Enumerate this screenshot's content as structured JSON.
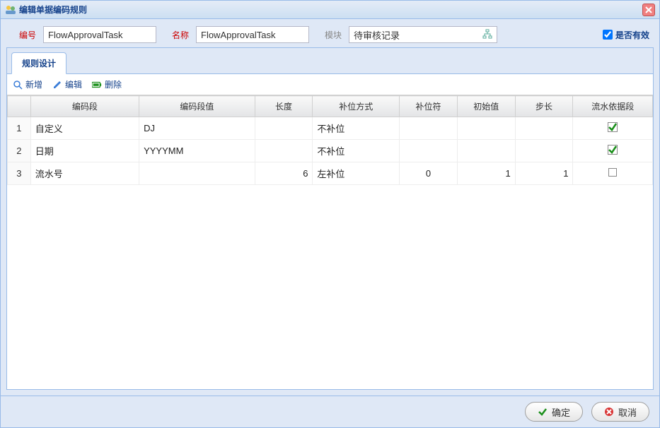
{
  "window": {
    "title": "编辑单据编码规则"
  },
  "form": {
    "id_label": "编号",
    "id_value": "FlowApprovalTask",
    "name_label": "名称",
    "name_value": "FlowApprovalTask",
    "module_label": "模块",
    "module_value": "待审核记录",
    "enabled_label": "是否有效",
    "enabled_checked": true
  },
  "tabs": {
    "rule_design": "规则设计"
  },
  "toolbar": {
    "add": "新增",
    "edit": "编辑",
    "delete": "删除"
  },
  "columns": {
    "rownum": "",
    "segment": "编码段",
    "segment_value": "编码段值",
    "length": "长度",
    "padding_mode": "补位方式",
    "padding_char": "补位符",
    "initial_value": "初始值",
    "step": "步长",
    "serial_by": "流水依据段"
  },
  "rows": [
    {
      "n": "1",
      "segment": "自定义",
      "segment_value": "DJ",
      "length": "",
      "padding_mode": "不补位",
      "padding_char": "",
      "initial_value": "",
      "step": "",
      "serial_by": true
    },
    {
      "n": "2",
      "segment": "日期",
      "segment_value": "YYYYMM",
      "length": "",
      "padding_mode": "不补位",
      "padding_char": "",
      "initial_value": "",
      "step": "",
      "serial_by": true
    },
    {
      "n": "3",
      "segment": "流水号",
      "segment_value": "",
      "length": "6",
      "padding_mode": "左补位",
      "padding_char": "0",
      "initial_value": "1",
      "step": "1",
      "serial_by": false
    }
  ],
  "footer": {
    "ok": "确定",
    "cancel": "取消"
  }
}
